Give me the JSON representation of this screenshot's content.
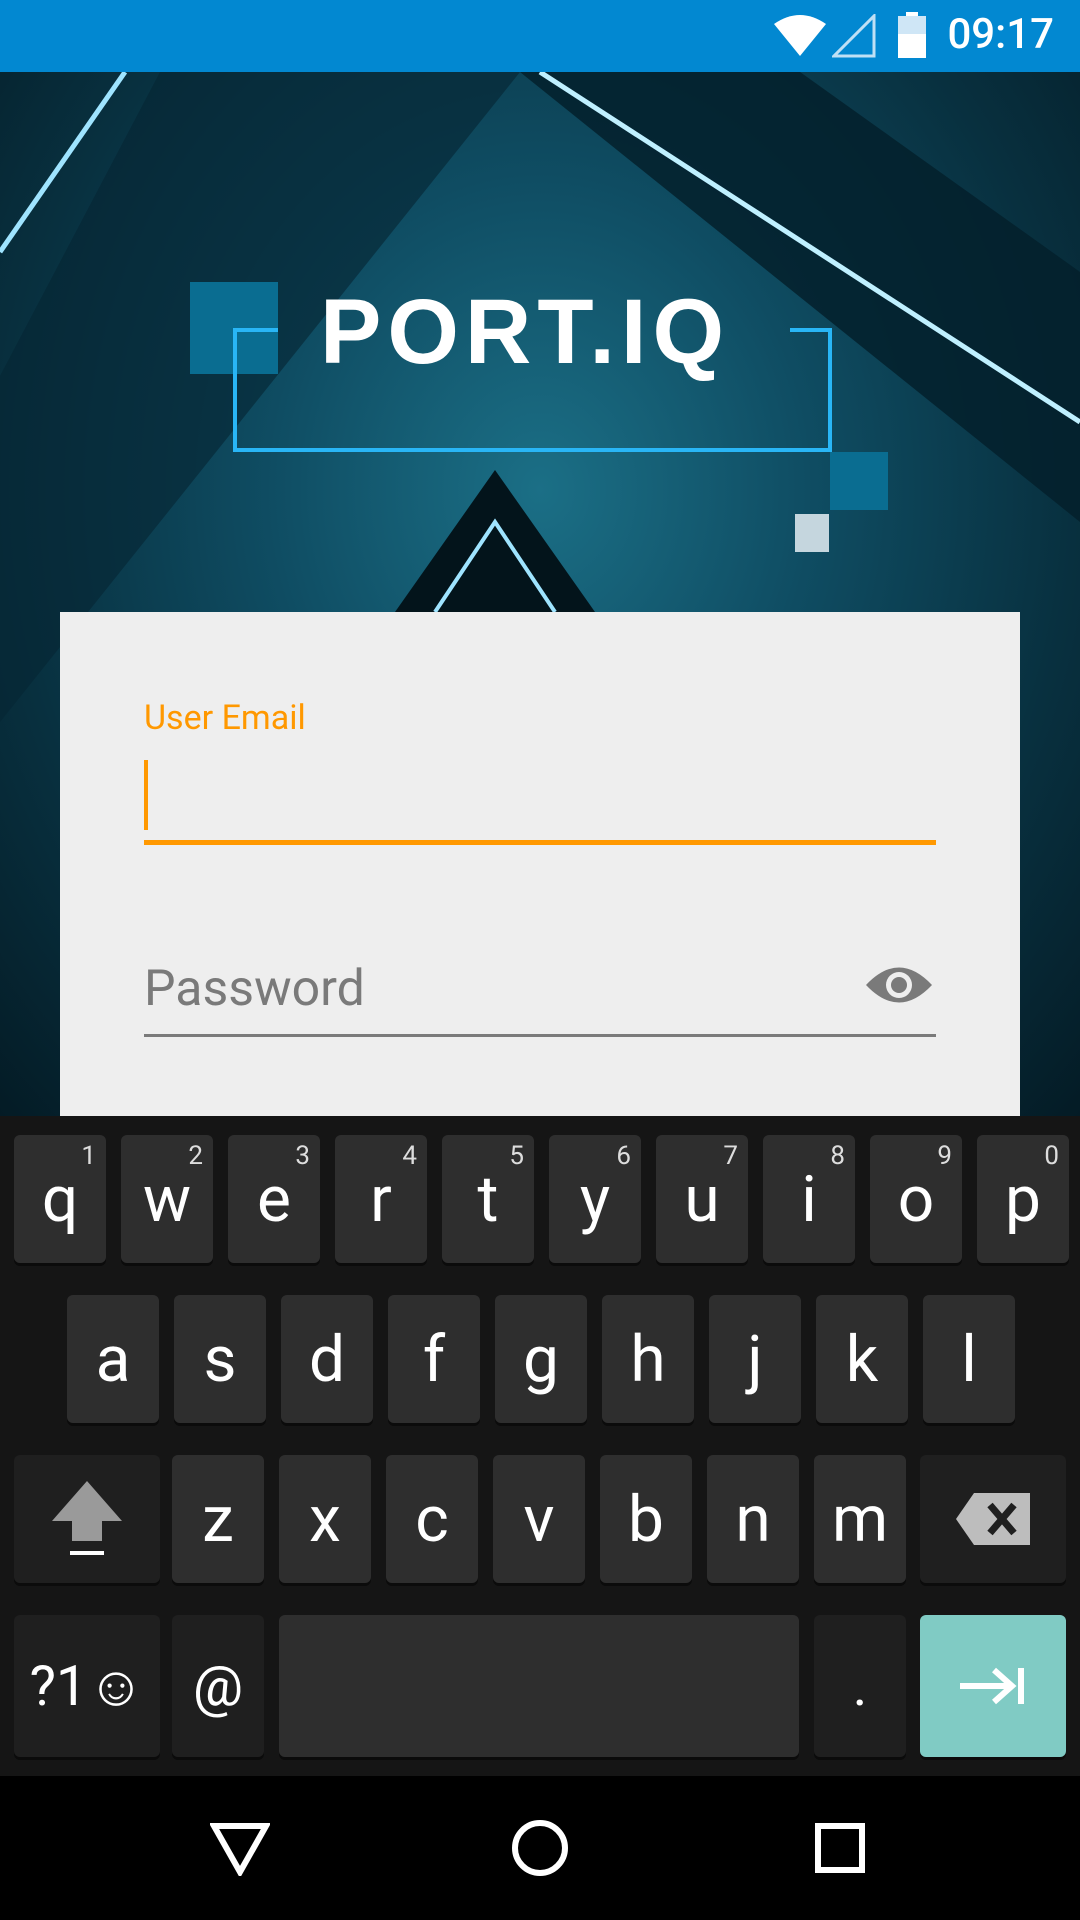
{
  "status_bar": {
    "time": "09:17",
    "battery_level": "43",
    "wifi_icon": "wifi-icon",
    "signal_icon": "cell-signal-icon",
    "battery_icon": "battery-icon"
  },
  "brand": {
    "logo_text": "PORT.IQ"
  },
  "login": {
    "email": {
      "label": "User Email",
      "value": ""
    },
    "password": {
      "placeholder": "Password",
      "toggle_icon": "eye-icon"
    }
  },
  "keyboard": {
    "rows": [
      [
        {
          "k": "q",
          "h": "1"
        },
        {
          "k": "w",
          "h": "2"
        },
        {
          "k": "e",
          "h": "3"
        },
        {
          "k": "r",
          "h": "4"
        },
        {
          "k": "t",
          "h": "5"
        },
        {
          "k": "y",
          "h": "6"
        },
        {
          "k": "u",
          "h": "7"
        },
        {
          "k": "i",
          "h": "8"
        },
        {
          "k": "o",
          "h": "9"
        },
        {
          "k": "p",
          "h": "0"
        }
      ],
      [
        {
          "k": "a"
        },
        {
          "k": "s"
        },
        {
          "k": "d"
        },
        {
          "k": "f"
        },
        {
          "k": "g"
        },
        {
          "k": "h"
        },
        {
          "k": "j"
        },
        {
          "k": "k"
        },
        {
          "k": "l"
        }
      ],
      [
        {
          "k": "z"
        },
        {
          "k": "x"
        },
        {
          "k": "c"
        },
        {
          "k": "v"
        },
        {
          "k": "b"
        },
        {
          "k": "n"
        },
        {
          "k": "m"
        }
      ]
    ],
    "symbols_label": "?1☺",
    "at_label": "@",
    "period_label": ".",
    "shift_icon": "shift-icon",
    "backspace_icon": "backspace-icon",
    "next_icon": "tab-next-icon"
  },
  "nav_bar": {
    "back_icon": "back-icon",
    "home_icon": "home-icon",
    "recents_icon": "recents-icon"
  }
}
